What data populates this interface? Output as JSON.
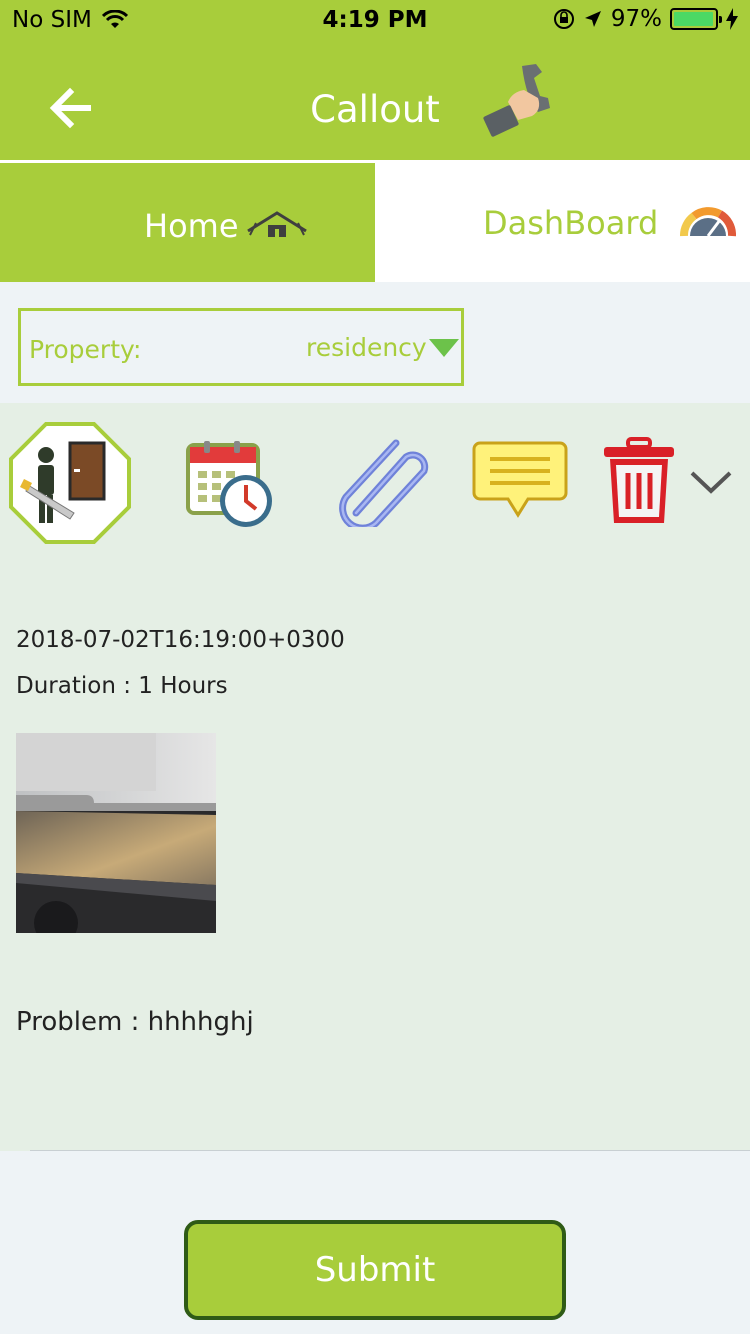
{
  "status_bar": {
    "carrier": "No SIM",
    "time": "4:19 PM",
    "battery_percent": "97%",
    "battery_level": 0.97,
    "icons": [
      "wifi-icon",
      "orientation-lock-icon",
      "location-arrow-icon",
      "battery-icon",
      "charging-bolt-icon"
    ]
  },
  "header": {
    "title": "Callout",
    "back_icon": "back-arrow-icon",
    "title_icon": "phone-handset-icon"
  },
  "tabs": [
    {
      "label": "Home",
      "icon": "house-icon",
      "active": true
    },
    {
      "label": "DashBoard",
      "icon": "gauge-icon",
      "active": false
    }
  ],
  "property": {
    "label": "Property:",
    "value": "residency"
  },
  "actions": [
    {
      "name": "worker-door-icon"
    },
    {
      "name": "calendar-clock-icon"
    },
    {
      "name": "paperclip-icon"
    },
    {
      "name": "chat-bubble-icon"
    },
    {
      "name": "trash-icon"
    },
    {
      "name": "chevron-down-icon"
    }
  ],
  "callout": {
    "date": "2018-07-02T16:19:00+0300",
    "duration": "Duration : 1 Hours",
    "problem": "Problem : hhhhghj"
  },
  "submit_label": "Submit",
  "colors": {
    "brand_green": "#a8cd3b",
    "button_border": "#2f5b16",
    "card_bg": "#e5efe5",
    "page_bg": "#eef3f6",
    "dropdown_arrow": "#6cc24a"
  }
}
